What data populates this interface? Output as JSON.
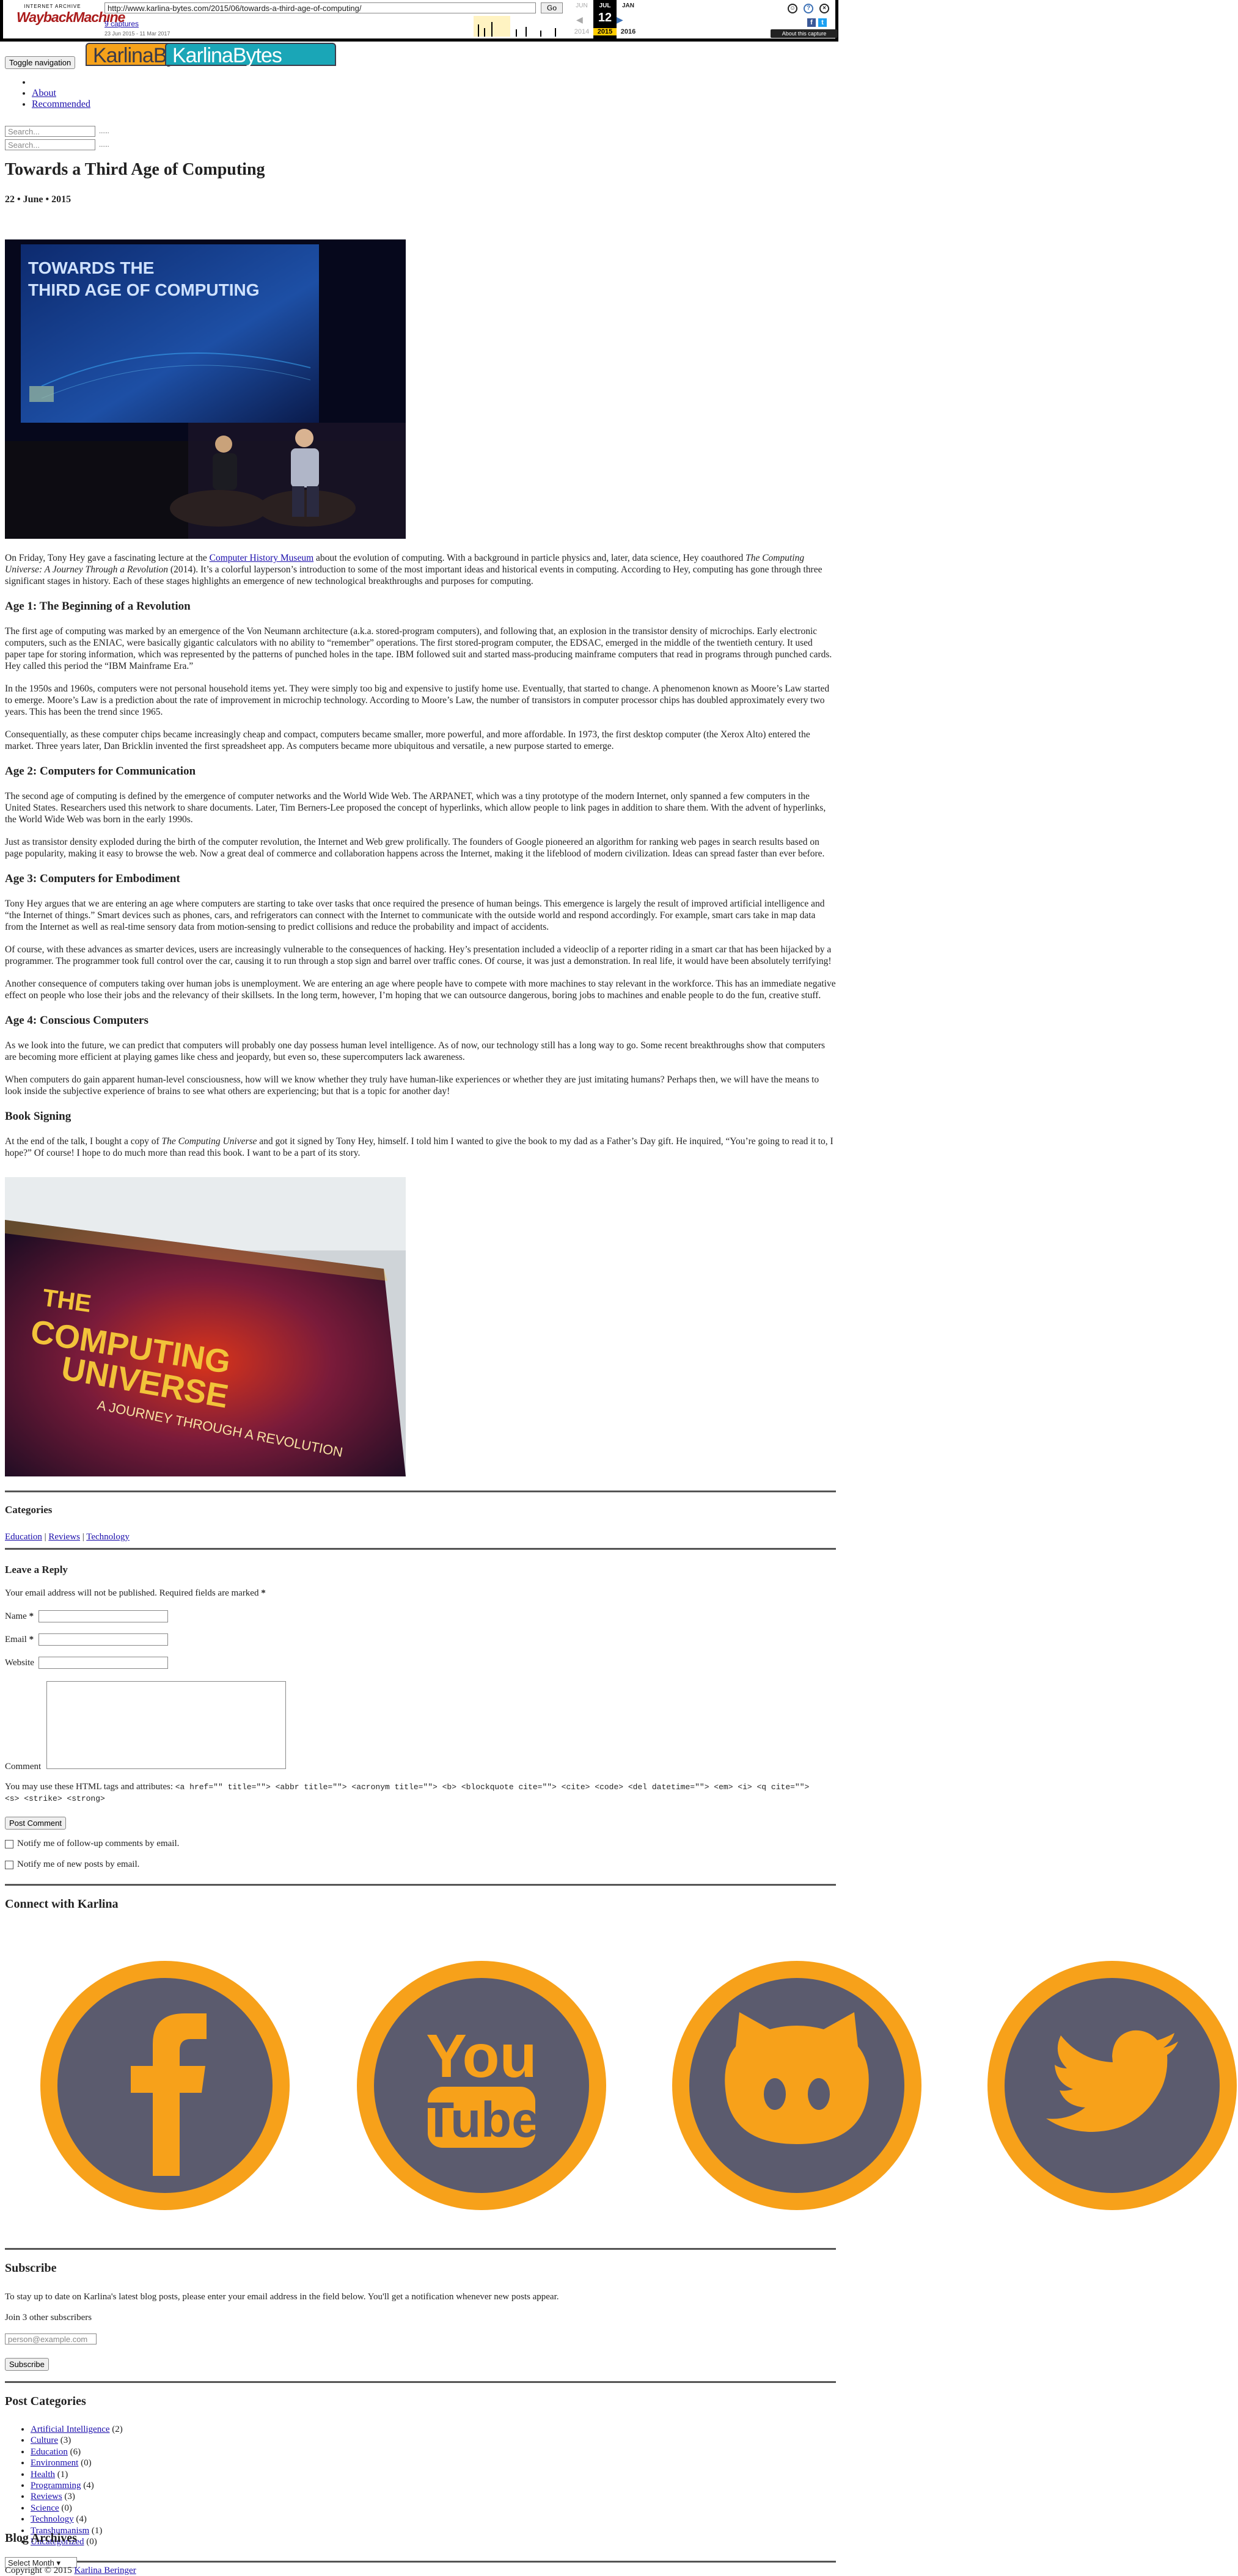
{
  "wayback": {
    "logo_small": "INTERNET ARCHIVE",
    "logo_main": "WaybackMachine",
    "url": "http://www.karlina-bytes.com/2015/06/towards-a-third-age-of-computing/",
    "go": "Go",
    "captures": "9 captures",
    "range": "23 Jun 2015 - 11 Mar 2017",
    "prev_month": "JUN",
    "cur_month": "JUL",
    "next_month": "JAN",
    "prev_year": "2014",
    "cur_day": "12",
    "cur_year": "2015",
    "next_year": "2016",
    "about": "About this capture"
  },
  "header": {
    "brand1": "KarlinaBytes",
    "brand2": "KarlinaBytes",
    "toggle": "Toggle navigation",
    "nav": [
      "About",
      "Recommended"
    ],
    "search_placeholder": "Search...",
    "search_btn": "......"
  },
  "post": {
    "title": "Towards a Third Age of Computing",
    "date": "22 • June • 2015",
    "photo1_text": "TOWARDS THE THIRD AGE OF COMPUTING",
    "intro_a": "On Friday, Tony Hey gave a fascinating lecture at the ",
    "intro_link": "Computer History Museum",
    "intro_b": " about the evolution of computing. With a background in particle physics and, later, data science, Hey coauthored ",
    "intro_book": "The Computing Universe: A Journey Through a Revolution",
    "intro_c": " (2014). It’s a colorful layperson’s introduction to some of the most important ideas and historical events in computing. According to Hey, computing has gone through three significant stages in history. Each of these stages highlights an emergence of new technological breakthroughs and purposes for computing.",
    "h_age1": "Age 1: The Beginning of a Revolution",
    "age1_p1": "The first age of computing was marked by an emergence of the Von Neumann architecture (a.k.a. stored-program computers), and following that, an explosion in the transistor density of microchips. Early electronic computers, such as the ENIAC, were basically gigantic calculators with no ability to “remember” operations. The first stored-program computer, the EDSAC, emerged in the middle of the twentieth century. It used paper tape for storing information, which was represented by the patterns of punched holes in the tape. IBM followed suit and started mass-producing mainframe computers that read in programs through punched cards. Hey called this period the “IBM Mainframe Era.”",
    "age1_p2": "In the 1950s and 1960s, computers were not personal household items yet. They were simply too big and expensive to justify home use. Eventually, that started to change. A phenomenon known as Moore’s Law started to emerge. Moore’s Law is a prediction about the rate of improvement in microchip technology. According to Moore’s Law, the number of transistors in computer processor chips has doubled approximately every two years. This has been the trend since 1965.",
    "age1_p3": "Consequentially, as these computer chips became increasingly cheap and compact, computers became smaller, more powerful, and more affordable. In 1973, the first desktop computer (the Xerox Alto) entered the market. Three years later, Dan Bricklin invented the first spreadsheet app. As computers became more ubiquitous and versatile, a new purpose started to emerge.",
    "h_age2": "Age 2: Computers for Communication",
    "age2_p1": "The second age of computing is defined by the emergence of computer networks and the World Wide Web. The ARPANET, which was a tiny prototype of the modern Internet, only spanned a few computers in the United States. Researchers used this network to share documents. Later, Tim Berners-Lee proposed the concept of hyperlinks, which allow people to link pages in addition to share them. With the advent of hyperlinks, the World Wide Web was born in the early 1990s.",
    "age2_p2": "Just as transistor density exploded during the birth of the computer revolution, the Internet and Web grew prolifically. The founders of Google pioneered an algorithm for ranking web pages in search results based on page popularity, making it easy to browse the web. Now a great deal of commerce and collaboration happens across the Internet, making it the lifeblood of modern civilization. Ideas can spread faster than ever before.",
    "h_age3": "Age 3: Computers for Embodiment",
    "age3_p1": "Tony Hey argues that we are entering an age where computers are starting to take over tasks that once required the presence of human beings. This emergence is largely the result of improved artificial intelligence and “the Internet of things.” Smart devices such as phones, cars, and refrigerators can connect with the Internet to communicate with the outside world and respond accordingly. For example, smart cars take in map data from the Internet as well as real-time sensory data from motion-sensing to predict collisions and reduce the probability and impact of accidents.",
    "age3_p2": "Of course, with these advances as smarter devices, users are increasingly vulnerable to the consequences of hacking. Hey’s presentation included a videoclip of a reporter riding in a smart car that has been hijacked by a programmer. The programmer took full control over the car, causing it to run through a stop sign and barrel over traffic cones. Of course, it was just a demonstration. In real life, it would have been absolutely terrifying!",
    "age3_p3": "Another consequence of computers taking over human jobs is unemployment. We are entering an age where people have to compete with more machines to stay relevant in the workforce. This has an immediate negative effect on people who lose their jobs and the relevancy of their skillsets. In the long term, however, I’m hoping that we can outsource dangerous, boring jobs to machines and enable people to do the fun, creative stuff.",
    "h_age4": "Age 4: Conscious Computers",
    "age4_p1": "As we look into the future, we can predict that computers will probably one day possess human level intelligence. As of now, our technology still has a long way to go. Some recent breakthroughs show that computers are becoming more efficient at playing games like chess and jeopardy, but even so, these supercomputers lack awareness.",
    "age4_p2": "When computers do gain apparent human-level consciousness, how will we know whether they truly have human-like experiences or whether they are just imitating humans? Perhaps then, we will have the means to look inside the subjective experience of brains to see what others are experiencing; but that is a topic for another day!",
    "h_book": "Book Signing",
    "book_a": "At the end of the talk, I bought a copy of ",
    "book_title": "The Computing Universe",
    "book_b": " and got it signed by Tony Hey, himself. I told him I wanted to give the book to my dad as a Father’s Day gift. He inquired, “You’re going to read it to, I hope?” Of course! I hope to do much more than read this book. I want to be a part of its story.",
    "photo2_line1": "THE",
    "photo2_line2": "COMPUTING",
    "photo2_line3": "UNIVERSE",
    "photo2_line4": "A JOURNEY THROUGH A REVOLUTION"
  },
  "categories_box": {
    "heading": "Categories",
    "items": [
      "Education",
      "Reviews",
      "Technology"
    ],
    "sep": " | "
  },
  "reply": {
    "heading": "Leave a Reply",
    "note": "Your email address will not be published. Required fields are marked ",
    "req": "*",
    "name_label": "Name ",
    "email_label": "Email ",
    "website_label": "Website",
    "comment_label": "Comment",
    "tags_a": "You may use these ",
    "tags_abbr": "HTML",
    "tags_b": " tags and attributes: ",
    "tags_code": "<a href=\"\" title=\"\"> <abbr title=\"\"> <acronym title=\"\"> <b> <blockquote cite=\"\"> <cite> <code> <del datetime=\"\"> <em> <i> <q cite=\"\"> <s> <strike> <strong>",
    "post_btn": "Post Comment",
    "notify1": "Notify me of follow-up comments by email.",
    "notify2": "Notify me of new posts by email."
  },
  "connect": {
    "heading": "Connect with Karlina",
    "icons": [
      "facebook-icon",
      "youtube-icon",
      "github-icon",
      "twitter-icon"
    ],
    "yt_you": "You",
    "yt_tube": "Tube",
    "ring_color": "#f7a11a",
    "fill_color": "#5b5b6e"
  },
  "subscribe": {
    "heading": "Subscribe",
    "text": "To stay up to date on Karlina's latest blog posts, please enter your email address in the field below. You'll get a notification whenever new posts appear.",
    "join": "Join 3 other subscribers",
    "placeholder": "person@example.com",
    "btn": "Subscribe"
  },
  "post_categories": {
    "heading": "Post Categories",
    "items": [
      {
        "name": "Artificial Intelligence",
        "count": "(2)"
      },
      {
        "name": "Culture",
        "count": "(3)"
      },
      {
        "name": "Education",
        "count": "(6)"
      },
      {
        "name": "Environment",
        "count": "(0)"
      },
      {
        "name": "Health",
        "count": "(1)"
      },
      {
        "name": "Programming",
        "count": "(4)"
      },
      {
        "name": "Reviews",
        "count": "(3)"
      },
      {
        "name": "Science",
        "count": "(0)"
      },
      {
        "name": "Technology",
        "count": "(4)"
      },
      {
        "name": "Transhumanism",
        "count": "(1)"
      },
      {
        "name": "Uncategorized",
        "count": "(0)"
      }
    ]
  },
  "archives": {
    "heading": "Blog Archives",
    "select": "Select Month ▾"
  },
  "footer": {
    "copy": "Copyright © 2015 ",
    "author": "Karlina Beringer"
  }
}
